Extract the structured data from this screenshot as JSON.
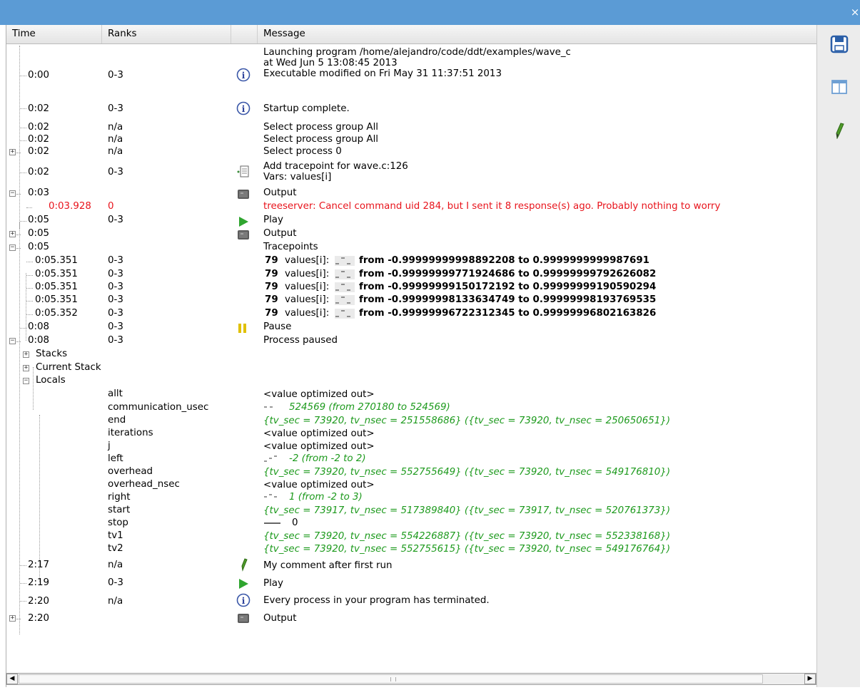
{
  "window": {
    "close_glyph": "×",
    "accent": "#5b9bd5"
  },
  "columns": {
    "time": "Time",
    "ranks": "Ranks",
    "message": "Message"
  },
  "colors": {
    "error": "#e8141c",
    "value": "#1d9a1d"
  },
  "rows": [
    {
      "time": "0:00",
      "ranks": "0-3",
      "icon": "info-icon",
      "msg": [
        "Launching program /home/alejandro/code/ddt/examples/wave_c",
        "at Wed Jun 5 13:08:45 2013",
        "Executable modified on Fri May 31 11:37:51 2013"
      ]
    },
    {
      "time": "0:02",
      "ranks": "0-3",
      "icon": "info-icon",
      "msg": [
        "Startup complete."
      ]
    },
    {
      "time": "0:02",
      "ranks": "n/a",
      "msg": [
        "Select process group All"
      ]
    },
    {
      "time": "0:02",
      "ranks": "n/a",
      "msg": [
        "Select process group All"
      ]
    },
    {
      "time": "0:02",
      "ranks": "n/a",
      "msg": [
        "Select process 0"
      ]
    },
    {
      "time": "0:02",
      "ranks": "0-3",
      "icon": "tracepoint-icon",
      "msg": [
        "Add tracepoint for wave.c:126",
        "Vars: values[i]"
      ]
    },
    {
      "time": "0:03",
      "ranks": "",
      "icon": "output-icon",
      "msg": [
        "Output"
      ]
    },
    {
      "time": "0:03.928",
      "ranks": "0",
      "msg": [
        "treeserver: Cancel command uid 284, but I sent it 8 response(s) ago. Probably nothing to worry"
      ]
    },
    {
      "time": "0:05",
      "ranks": "0-3",
      "icon": "play-icon",
      "msg": [
        "Play"
      ]
    },
    {
      "time": "0:05",
      "ranks": "",
      "icon": "output-icon",
      "msg": [
        "Output"
      ]
    },
    {
      "time": "0:05",
      "ranks": "",
      "msg": [
        "Tracepoints"
      ]
    },
    {
      "time": "0:05.351",
      "ranks": "0-3",
      "tp": {
        "count": "79",
        "var": "values[i]:",
        "range": "from -0.99999999998892208 to 0.9999999999987691"
      }
    },
    {
      "time": "0:05.351",
      "ranks": "0-3",
      "tp": {
        "count": "79",
        "var": "values[i]:",
        "range": "from -0.99999999771924686 to 0.99999999792626082"
      }
    },
    {
      "time": "0:05.351",
      "ranks": "0-3",
      "tp": {
        "count": "79",
        "var": "values[i]:",
        "range": "from -0.99999999150172192 to 0.99999999190590294"
      }
    },
    {
      "time": "0:05.351",
      "ranks": "0-3",
      "tp": {
        "count": "79",
        "var": "values[i]:",
        "range": "from -0.99999998133634749 to 0.99999998193769535"
      }
    },
    {
      "time": "0:05.352",
      "ranks": "0-3",
      "tp": {
        "count": "79",
        "var": "values[i]:",
        "range": "from -0.99999996722312345 to 0.99999996802163826"
      }
    },
    {
      "time": "0:08",
      "ranks": "0-3",
      "icon": "pause-icon",
      "msg": [
        "Pause"
      ]
    },
    {
      "time": "0:08",
      "ranks": "0-3",
      "msg": [
        "Process paused"
      ]
    },
    {
      "time": "Stacks"
    },
    {
      "time": "Current Stack"
    },
    {
      "time": "Locals"
    },
    {
      "ranks": "allt",
      "msg": [
        "<value optimized out>"
      ]
    },
    {
      "ranks": "communication_usec",
      "val": "524569 (from 270180 to 524569)"
    },
    {
      "ranks": "end",
      "val": "{tv_sec = 73920, tv_nsec = 251558686} ({tv_sec = 73920, tv_nsec = 250650651})"
    },
    {
      "ranks": "iterations",
      "msg": [
        "<value optimized out>"
      ]
    },
    {
      "ranks": "j",
      "msg": [
        "<value optimized out>"
      ]
    },
    {
      "ranks": "left",
      "val": "-2 (from -2 to 2)"
    },
    {
      "ranks": "overhead",
      "val": "{tv_sec = 73920, tv_nsec = 552755649} ({tv_sec = 73920, tv_nsec = 549176810})"
    },
    {
      "ranks": "overhead_nsec",
      "msg": [
        "<value optimized out>"
      ]
    },
    {
      "ranks": "right",
      "val": "1 (from -2 to 3)"
    },
    {
      "ranks": "start",
      "val": "{tv_sec = 73917, tv_nsec = 517389840} ({tv_sec = 73917, tv_nsec = 520761373})"
    },
    {
      "ranks": "stop",
      "msg": [
        "0"
      ]
    },
    {
      "ranks": "tv1",
      "val": "{tv_sec = 73920, tv_nsec = 554226887} ({tv_sec = 73920, tv_nsec = 552338168})"
    },
    {
      "ranks": "tv2",
      "val": "{tv_sec = 73920, tv_nsec = 552755615} ({tv_sec = 73920, tv_nsec = 549176764})"
    },
    {
      "time": "2:17",
      "ranks": "n/a",
      "icon": "pencil-icon",
      "msg": [
        "My comment after first run"
      ]
    },
    {
      "time": "2:19",
      "ranks": "0-3",
      "icon": "play-icon",
      "msg": [
        "Play"
      ]
    },
    {
      "time": "2:20",
      "ranks": "n/a",
      "icon": "info-icon",
      "msg": [
        "Every process in your program has terminated."
      ]
    },
    {
      "time": "2:20",
      "ranks": "",
      "icon": "output-icon",
      "msg": [
        "Output"
      ]
    }
  ],
  "sidebar": {
    "icons": [
      "save-icon",
      "panel-layout-icon",
      "pencil-icon"
    ]
  }
}
